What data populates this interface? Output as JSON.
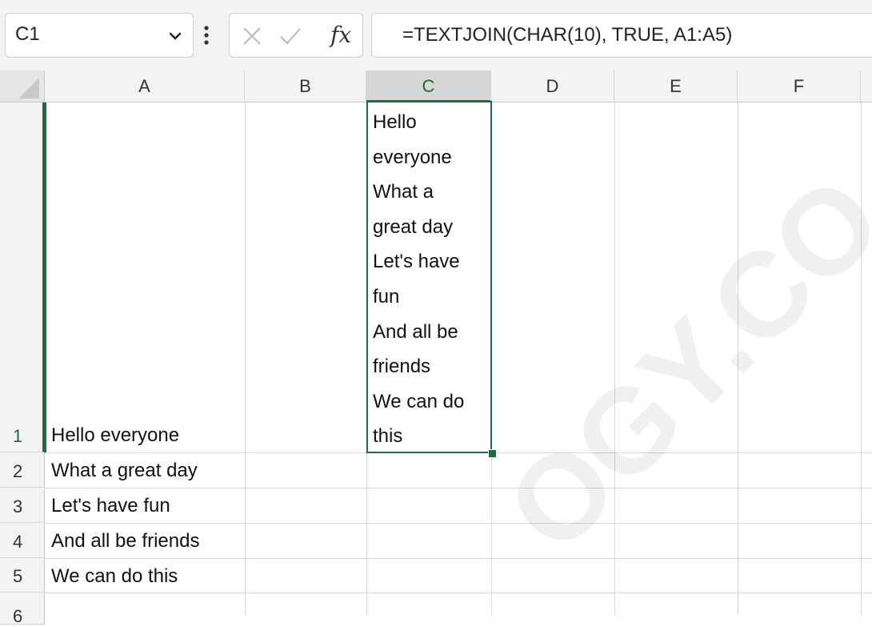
{
  "formula_bar": {
    "name_box": "C1",
    "formula": "=TEXTJOIN(CHAR(10), TRUE, A1:A5)",
    "fx_label": "fx"
  },
  "columns": [
    "A",
    "B",
    "C",
    "D",
    "E",
    "F"
  ],
  "rows": [
    "1",
    "2",
    "3",
    "4",
    "5",
    "6"
  ],
  "cells": {
    "A1": "Hello everyone",
    "A2": "What a great day",
    "A3": "Let's have fun",
    "A4": "And all be friends",
    "A5": "We can do this"
  },
  "c1_lines": [
    "Hello",
    "everyone",
    "What a",
    "great day",
    "Let's have",
    "fun",
    "And all be",
    "friends",
    "We can do",
    "this"
  ],
  "watermark": "OGY.CO",
  "colors": {
    "selection": "#1e6b3e",
    "header_bg": "#f3f3f3"
  }
}
